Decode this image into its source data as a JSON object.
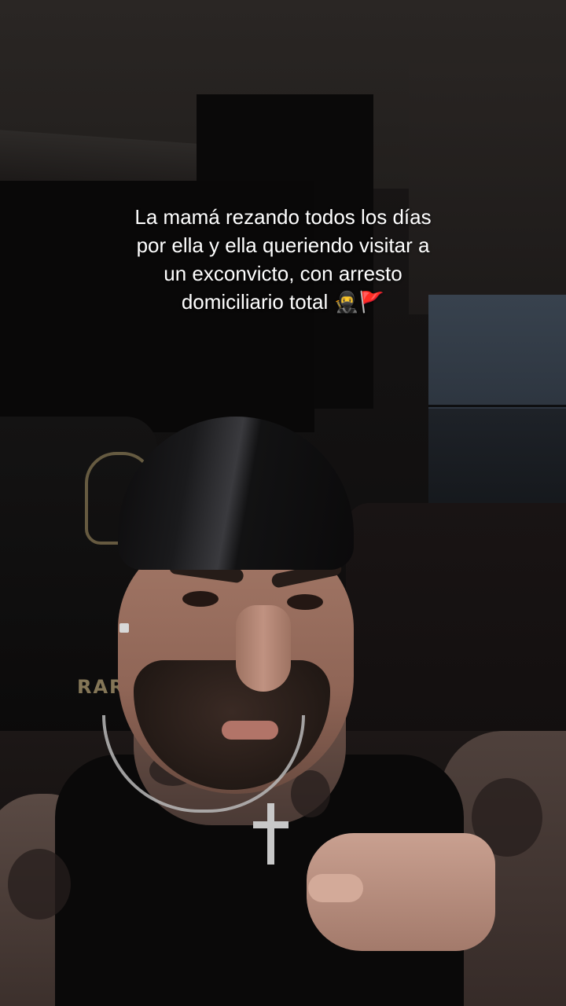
{
  "caption": {
    "text": "La mamá rezando todos los días\npor ella y ella queriendo visitar a\nun exconvicto, con arresto\ndomiciliario total 🥷🚩",
    "emoji_icons": [
      "ninja-emoji",
      "red-flag-emoji"
    ]
  },
  "background": {
    "chair_brand_text": "RAR"
  },
  "colors": {
    "caption_text": "#ffffff",
    "window_sky": "#38424e",
    "chair_logo": "#8a7a56"
  }
}
